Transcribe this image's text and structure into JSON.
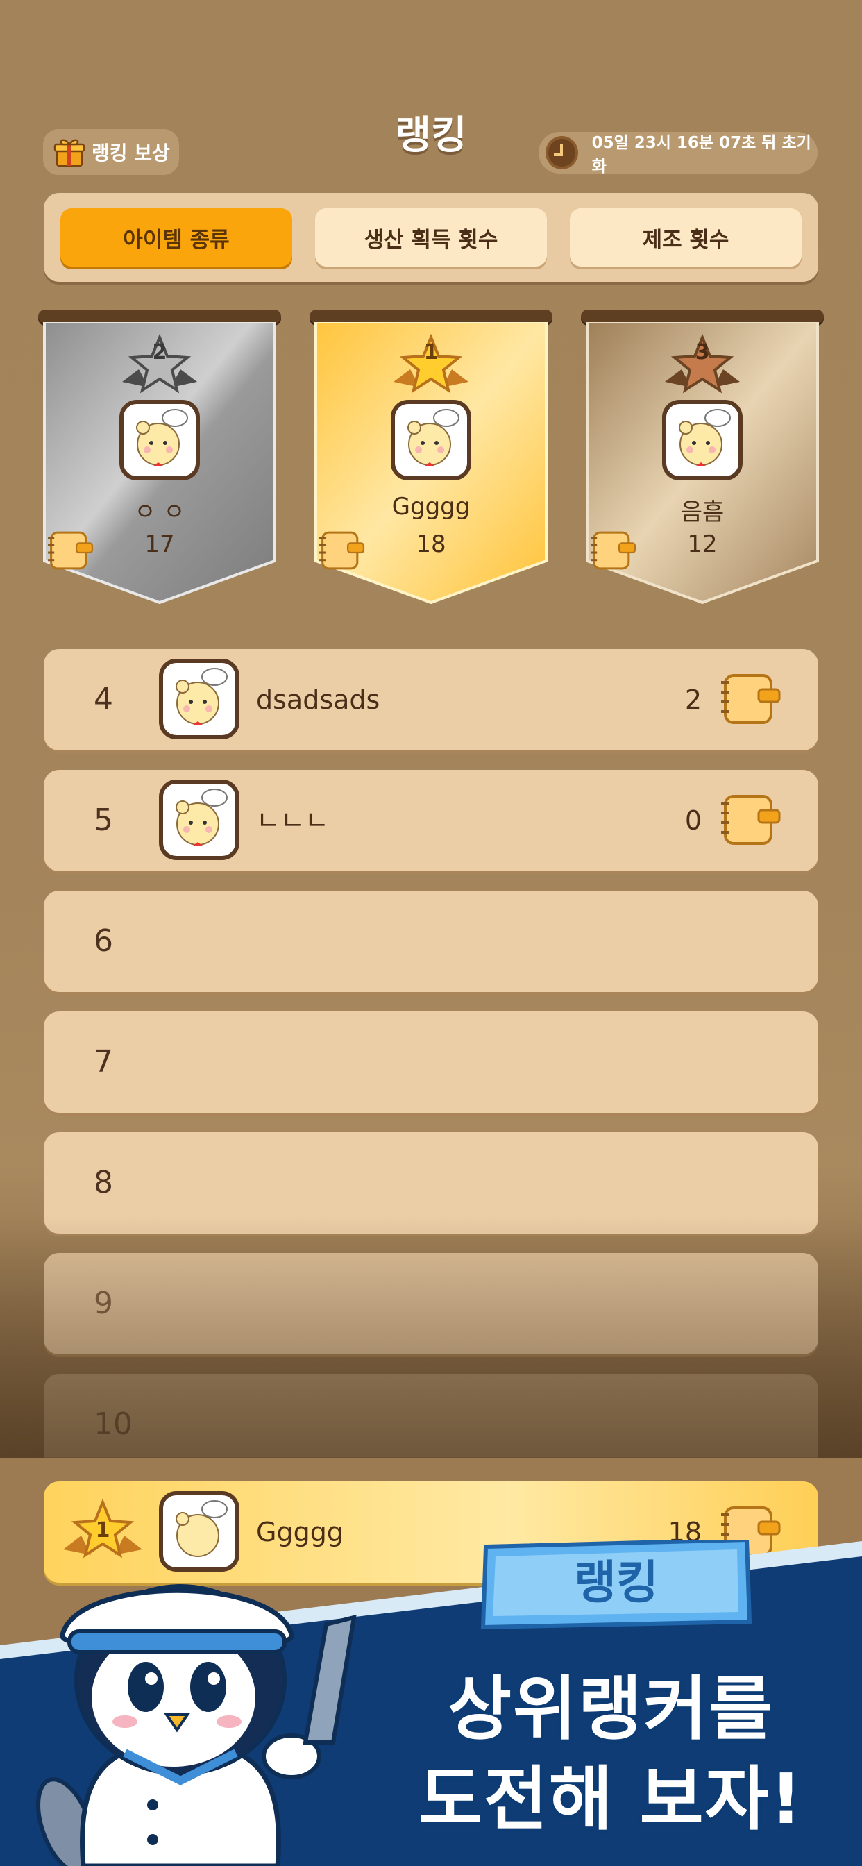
{
  "header": {
    "title": "랭킹",
    "reward_label": "랭킹 보상",
    "reset_timer": "05일 23시 16분 07초 뒤 초기화"
  },
  "tabs": [
    {
      "label": "아이템 종류",
      "active": true
    },
    {
      "label": "생산 획득 횟수",
      "active": false
    },
    {
      "label": "제조 횟수",
      "active": false
    }
  ],
  "podium": {
    "first": {
      "rank": "1",
      "name": "Ggggg",
      "score": "18"
    },
    "second": {
      "rank": "2",
      "name": "ㅇ ㅇ",
      "score": "17"
    },
    "third": {
      "rank": "3",
      "name": "음흠",
      "score": "12"
    }
  },
  "list": [
    {
      "rank": "4",
      "name": "dsadsads",
      "score": "2"
    },
    {
      "rank": "5",
      "name": "ㄴㄴㄴ",
      "score": "0"
    },
    {
      "rank": "6",
      "name": "",
      "score": ""
    },
    {
      "rank": "7",
      "name": "",
      "score": ""
    },
    {
      "rank": "8",
      "name": "",
      "score": ""
    },
    {
      "rank": "9",
      "name": "",
      "score": ""
    },
    {
      "rank": "10",
      "name": "",
      "score": ""
    }
  ],
  "my_rank": {
    "rank": "1",
    "name": "Ggggg",
    "score": "18"
  },
  "promo": {
    "tag": "랭킹",
    "line1": "상위랭커를",
    "line2": "도전해 보자!"
  },
  "colors": {
    "background": "#a4845a",
    "tab_active": "#fba50c",
    "tab_inactive": "#fde8c6",
    "row": "#ebcda6",
    "gold": "#ffd35c",
    "silver": "#a8a8a8",
    "bronze": "#b0916a",
    "promo_blue": "#0f3c74"
  }
}
